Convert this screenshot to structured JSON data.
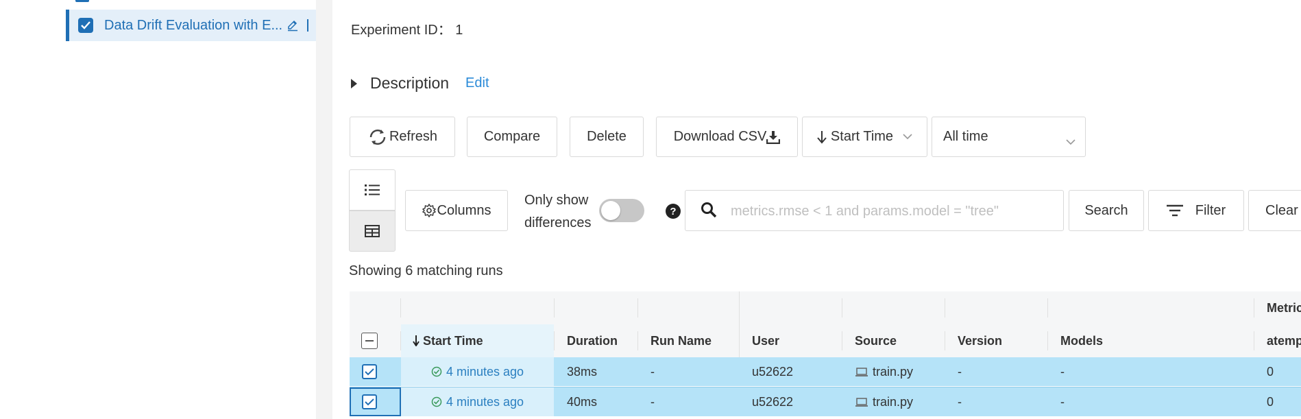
{
  "sidebar": {
    "experiment_name": "Data Drift Evaluation with E...",
    "extra_glyph": "1"
  },
  "main": {
    "experiment_id": "Experiment ID： 1",
    "description_label": "Description",
    "description_edit": "Edit"
  },
  "toolbar": {
    "refresh": "Refresh",
    "compare": "Compare",
    "delete": "Delete",
    "download_csv": "Download CSV",
    "sort": "Start Time",
    "time_range": "All time"
  },
  "filterbar": {
    "columns": "Columns",
    "only_show_line1": "Only show",
    "only_show_line2": "differences",
    "help": "?",
    "search_placeholder": "metrics.rmse < 1 and params.model = \"tree\"",
    "search_value": "",
    "search_button": "Search",
    "filter_button": "Filter",
    "clear_button": "Clear"
  },
  "results": {
    "showing_text": "Showing 6 matching runs"
  },
  "table": {
    "group_header_metrics": "Metrics",
    "columns": [
      "Start Time",
      "Duration",
      "Run Name",
      "User",
      "Source",
      "Version",
      "Models",
      "atemp"
    ],
    "rows": [
      {
        "start_time": "4 minutes ago",
        "duration": "38ms",
        "run_name": "-",
        "user": "u52622",
        "source": "train.py",
        "version": "-",
        "models": "-",
        "metric": "0",
        "selected": true
      },
      {
        "start_time": "4 minutes ago",
        "duration": "40ms",
        "run_name": "-",
        "user": "u52622",
        "source": "train.py",
        "version": "-",
        "models": "-",
        "metric": "0",
        "selected": true
      }
    ]
  },
  "colors": {
    "accent": "#1f6fb5",
    "link": "#2a8ad8",
    "row_selected": "#b5e3f8",
    "success": "#3a9a5b"
  },
  "icons": [
    "check-icon",
    "edit-icon",
    "caret-right-icon",
    "refresh-icon",
    "download-icon",
    "arrow-down-icon",
    "chevron-down-icon",
    "list-view-icon",
    "table-view-icon",
    "gear-icon",
    "help-icon",
    "search-icon",
    "filter-icon",
    "checkbox-icon",
    "success-check-icon",
    "laptop-icon"
  ]
}
